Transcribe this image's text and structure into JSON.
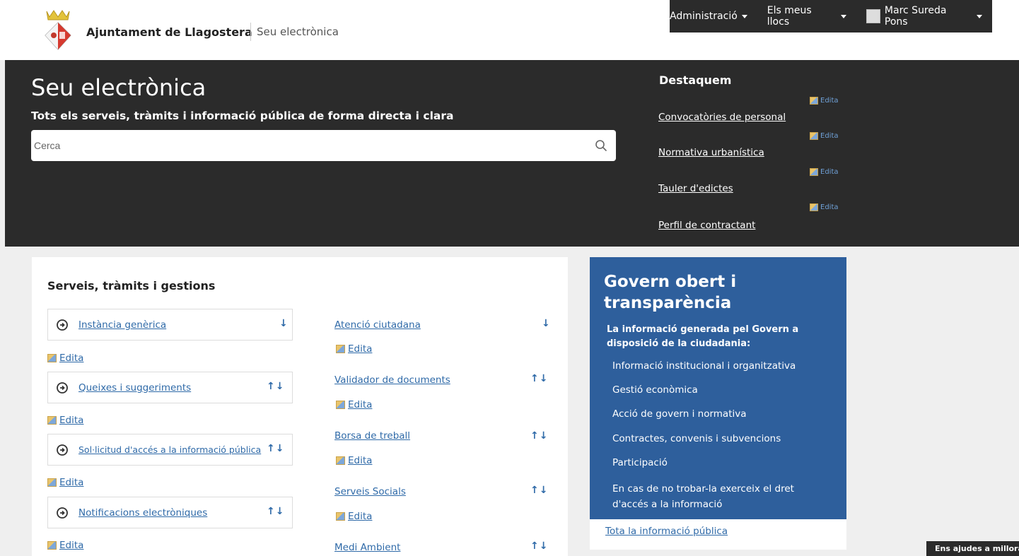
{
  "header": {
    "site_name": "Ajuntament de Llagostera",
    "section": "Seu electrònica",
    "menu": {
      "administracio": "Administració",
      "llocs": "Els meus llocs",
      "user": "Marc Sureda Pons"
    }
  },
  "hero": {
    "title": "Seu electrònica",
    "subtitle": "Tots els serveis, tràmits i informació pública de forma directa i clara",
    "search_placeholder": "Cerca",
    "featured_title": "Destaquem",
    "edit_label": "Edita",
    "featured": [
      "Convocatòries de personal",
      "Normativa urbanística",
      "Tauler d'edictes",
      "Perfil de contractant"
    ]
  },
  "services": {
    "title": "Serveis, tràmits i gestions",
    "edit_label": "Edita",
    "col1": [
      "Instància genèrica",
      "Queixes i suggeriments",
      "Sol·licitud d'accés a la informació pública",
      "Notificacions electròniques"
    ],
    "col2": [
      "Atenció ciutadana",
      "Validador de documents",
      "Borsa de treball",
      "Serveis Socials",
      "Medi Ambient"
    ]
  },
  "govern": {
    "title": "Govern obert i transparència",
    "description": "La informació generada pel Govern a disposició de la ciudadania:",
    "items": [
      "Informació institucional i organitzativa",
      "Gestió econòmica",
      "Acció de govern i normativa",
      "Contractes, convenis i subvencions",
      "Participació"
    ],
    "last_item": "En cas de no trobar-la exerceix el dret d'accés a la informació",
    "footer_link": "Tota la informació pública"
  },
  "feedback": "Ens ajudes a millorar?",
  "colors": {
    "dark": "#2b2b2b",
    "blue": "#2e5f9c",
    "link": "#2f6aa8"
  }
}
